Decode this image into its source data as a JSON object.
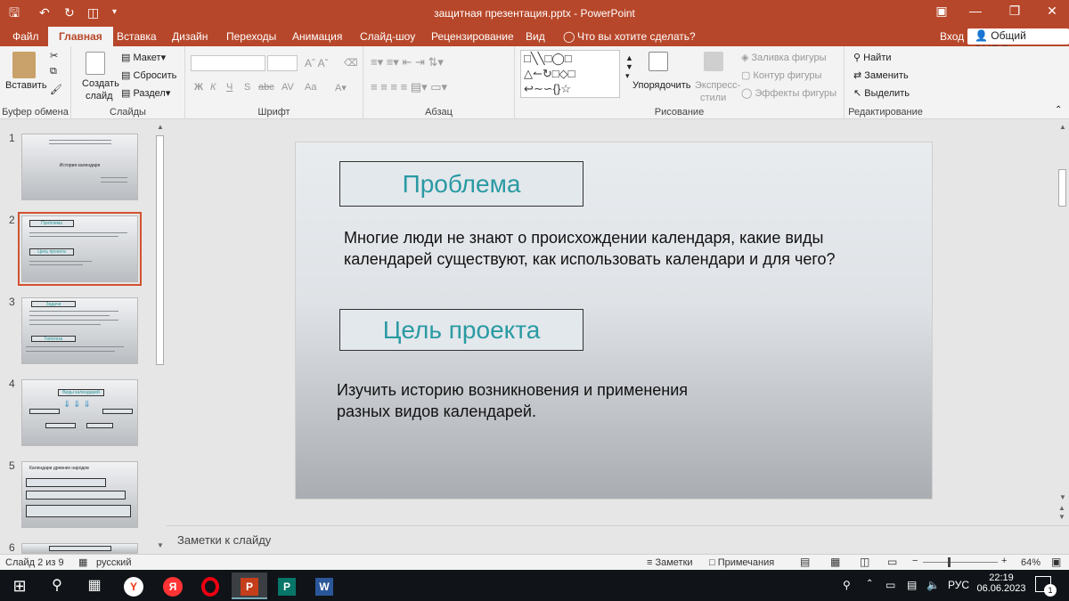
{
  "window": {
    "title": "защитная презентация.pptx - PowerPoint",
    "signin": "Вход",
    "share": "Общий доступ"
  },
  "tabs": [
    "Файл",
    "Главная",
    "Вставка",
    "Дизайн",
    "Переходы",
    "Анимация",
    "Слайд-шоу",
    "Рецензирование",
    "Вид"
  ],
  "tellme": "Что вы хотите сделать?",
  "ribbon": {
    "clipboard": {
      "paste": "Вставить",
      "group": "Буфер обмена"
    },
    "slides": {
      "new_slide_1": "Создать",
      "new_slide_2": "слайд",
      "layout": "Макет",
      "reset": "Сбросить",
      "section": "Раздел",
      "group": "Слайды"
    },
    "font": {
      "group": "Шрифт",
      "bold": "Ж",
      "italic": "К",
      "underline": "Ч",
      "shadow": "S",
      "strike": "abc",
      "spacing": "AV",
      "case": "Aa"
    },
    "paragraph": {
      "group": "Абзац"
    },
    "drawing": {
      "arrange": "Упорядочить",
      "styles_1": "Экспресс-",
      "styles_2": "стили",
      "fill": "Заливка фигуры",
      "outline": "Контур фигуры",
      "effects": "Эффекты фигуры",
      "group": "Рисование"
    },
    "editing": {
      "find": "Найти",
      "replace": "Заменить",
      "select": "Выделить",
      "group": "Редактирование"
    }
  },
  "thumbnails": [
    {
      "num": "1",
      "title": "История календаря",
      "selected": false
    },
    {
      "num": "2",
      "title": "Проблема",
      "title2": "Цель проекта",
      "selected": true
    },
    {
      "num": "3",
      "title": "Задачи",
      "title2": "Гипотеза",
      "selected": false
    },
    {
      "num": "4",
      "title": "Виды календарей",
      "selected": false
    },
    {
      "num": "5",
      "title": "Календари древних народов",
      "selected": false
    },
    {
      "num": "6",
      "selected": false
    }
  ],
  "slide": {
    "heading1": "Проблема",
    "text1": "Многие люди не знают о происхождении календаря, какие виды календарей существуют, как использовать календари и для чего?",
    "heading2": "Цель проекта",
    "text2_line1": "Изучить историю возникновения и применения",
    "text2_line2": "разных видов календарей."
  },
  "notes": {
    "placeholder": "Заметки к слайду"
  },
  "status": {
    "slide": "Слайд 2 из 9",
    "lang": "русский",
    "notes_btn": "Заметки",
    "comments_btn": "Примечания",
    "zoom": "64%",
    "zoom_level": 0.33
  },
  "taskbar": {
    "lang": "РУС",
    "time": "22:19",
    "date": "06.06.2023",
    "notif_count": "1"
  },
  "colors": {
    "accent": "#b7472a",
    "teal": "#2a9aa3"
  }
}
